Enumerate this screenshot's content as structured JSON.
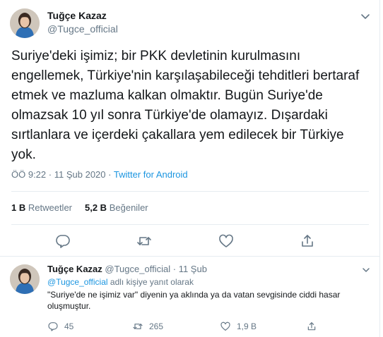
{
  "tweet": {
    "author_name": "Tuğçe Kazaz",
    "author_handle": "@Tugce_official",
    "text": "Suriye'deki işimiz; bir PKK devletinin kurulmasını engellemek, Türkiye'nin karşılaşabileceği tehditleri bertaraf etmek ve mazluma kalkan olmaktır. Bugün Suriye'de olmazsak 10 yıl sonra Türkiye'de olamayız. Dışardaki sırtlanlara ve içerdeki çakallara yem edilecek bir Türkiye yok.",
    "time": "ÖÖ 9:22",
    "date": "11 Şub 2020",
    "dot": "·",
    "source": "Twitter for Android",
    "retweets_count": "1 B",
    "retweets_label": "Retweetler",
    "likes_count": "5,2 B",
    "likes_label": "Beğeniler"
  },
  "reply": {
    "author_name": "Tuğçe Kazaz",
    "author_handle": "@Tugce_official",
    "dot": "·",
    "date": "11 Şub",
    "replying_mention": "@Tugce_official",
    "replying_suffix": "adlı kişiye yanıt olarak",
    "text": "\"Suriye'de ne işimiz var\" diyenin ya aklında ya da vatan sevgisinde ciddi hasar oluşmuştur.",
    "reply_count": "45",
    "retweet_count": "265",
    "like_count": "1,9 B"
  },
  "icons": {
    "caret": "chevron-down-icon",
    "reply": "reply-icon",
    "retweet": "retweet-icon",
    "like": "heart-icon",
    "share": "share-icon"
  },
  "colors": {
    "text": "#14171a",
    "secondary": "#657786",
    "link": "#1b95e0",
    "border": "#e6ecf0"
  }
}
